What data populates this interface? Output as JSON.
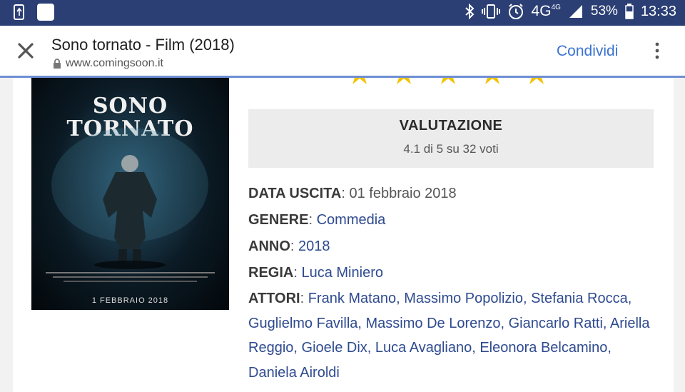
{
  "status_bar": {
    "network": "4G",
    "network_badge": "4G",
    "battery": "53%",
    "time": "13:33",
    "icons": [
      "data-saver-icon",
      "app-notification-icon",
      "bluetooth-icon",
      "vibrate-icon",
      "alarm-icon",
      "signal-icon",
      "battery-icon"
    ]
  },
  "toolbar": {
    "title": "Sono tornato - Film (2018)",
    "url": "www.comingsoon.it",
    "share_label": "Condividi",
    "accent": "#3b73d1"
  },
  "poster": {
    "title_line1": "SONO",
    "title_line2": "TORNATO",
    "date": "1 FEBBRAIO 2018"
  },
  "rating": {
    "title": "VALUTAZIONE",
    "value": "4.1 di 5 su 32 voti",
    "stars_color": "#f2c200"
  },
  "details": [
    {
      "label": "DATA USCITA",
      "value": "01 febbraio 2018",
      "link": false
    },
    {
      "label": "GENERE",
      "value": "Commedia",
      "link": true
    },
    {
      "label": "ANNO",
      "value": "2018",
      "link": true
    },
    {
      "label": "REGIA",
      "value": "Luca Miniero",
      "link": true
    }
  ],
  "cast": {
    "label": "ATTORI",
    "actors": [
      "Frank Matano",
      "Massimo Popolizio",
      "Stefania Rocca",
      "Guglielmo Favilla",
      "Massimo De Lorenzo",
      "Giancarlo Ratti",
      "Ariella Reggio",
      "Gioele Dix",
      "Luca Avagliano",
      "Eleonora Belcamino",
      "Daniela Airoldi"
    ]
  }
}
